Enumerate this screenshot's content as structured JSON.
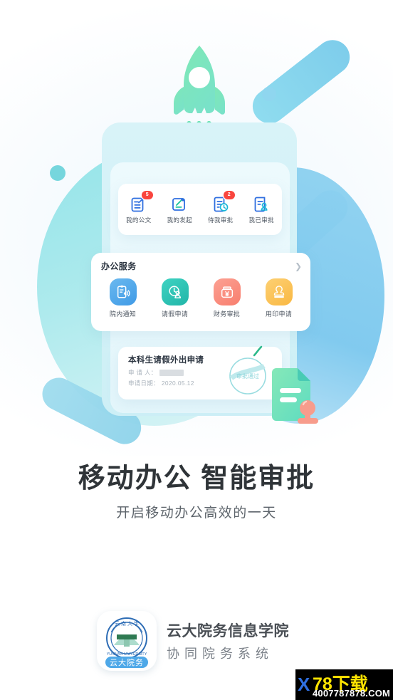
{
  "background": {
    "rocket_icon": "rocket-icon",
    "accent_cyan": "#8fe3e8",
    "accent_blue": "#7cc8ee",
    "accent_green": "#6fe0b0"
  },
  "mockup": {
    "quick_actions": [
      {
        "label": "我的公文",
        "icon": "document-arrow-icon",
        "badge": "5"
      },
      {
        "label": "我的发起",
        "icon": "edit-document-icon",
        "badge": ""
      },
      {
        "label": "待我审批",
        "icon": "pending-clock-icon",
        "badge": "2"
      },
      {
        "label": "我已审批",
        "icon": "approved-person-icon",
        "badge": ""
      }
    ],
    "service": {
      "title": "办公服务",
      "arrow_icon": "chevron-right-icon",
      "items": [
        {
          "label": "院内通知",
          "icon": "announcement-icon",
          "color": "#4aa3e8"
        },
        {
          "label": "请假申请",
          "icon": "leave-clock-person-icon",
          "color": "#2ec4b6"
        },
        {
          "label": "财务审批",
          "icon": "finance-yen-icon",
          "color": "#fb8d7e"
        },
        {
          "label": "用印申请",
          "icon": "seal-stamp-icon",
          "color": "#fcc251"
        }
      ]
    },
    "document_card": {
      "title": "本科生请假外出申请",
      "applicant_label": "申 请 人：",
      "applicant_value": "",
      "date_label": "申请日期：",
      "date_value": "2020.05.12",
      "seal_text": "审批通过",
      "seal_icon": "approval-seal-icon",
      "check_icon": "check-mark-icon",
      "side_icon": "green-document-stamp-icon"
    }
  },
  "headline": {
    "title": "移动办公 智能审批",
    "subtitle": "开启移动办公高效的一天"
  },
  "footer": {
    "app_icon": "yunnan-university-app-icon",
    "app_icon_ribbon": "云大院务",
    "brand_line1": "云大院务信息学院",
    "brand_line2": "协同院务系统"
  },
  "watermark": {
    "logo_letter": "X",
    "main": "78下载",
    "url": "4007787878.COM"
  }
}
